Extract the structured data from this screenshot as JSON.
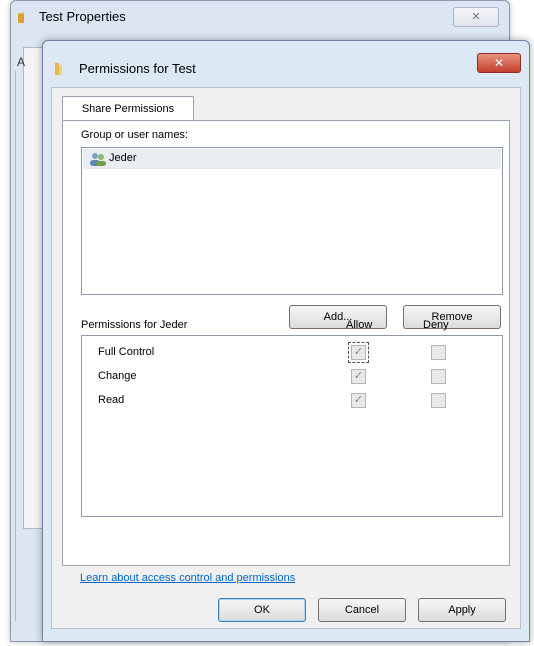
{
  "back_window": {
    "title": "Test Properties",
    "close_glyph": "✕",
    "partial_tab_letter": "A"
  },
  "front_window": {
    "title": "Permissions for Test",
    "close_glyph": "✕"
  },
  "tabs": [
    {
      "label": "Share Permissions",
      "selected": true
    }
  ],
  "group_section": {
    "label": "Group or user names:",
    "users": [
      {
        "name": "Jeder",
        "icon": "users-group-icon",
        "selected": true
      }
    ]
  },
  "buttons": {
    "add": "Add...",
    "remove": "Remove",
    "ok": "OK",
    "cancel": "Cancel",
    "apply": "Apply"
  },
  "permissions": {
    "label": "Permissions for Jeder",
    "allow_header": "Allow",
    "deny_header": "Deny",
    "rows": [
      {
        "name": "Full Control",
        "allow": true,
        "deny": false
      },
      {
        "name": "Change",
        "allow": true,
        "deny": false
      },
      {
        "name": "Read",
        "allow": true,
        "deny": false
      }
    ]
  },
  "link_text": "Learn about access control and permissions",
  "check_glyph": "✓",
  "colors": {
    "close_button_red": "#c3412e",
    "link_blue": "#0066cc",
    "window_frame": "#dde8f5"
  }
}
